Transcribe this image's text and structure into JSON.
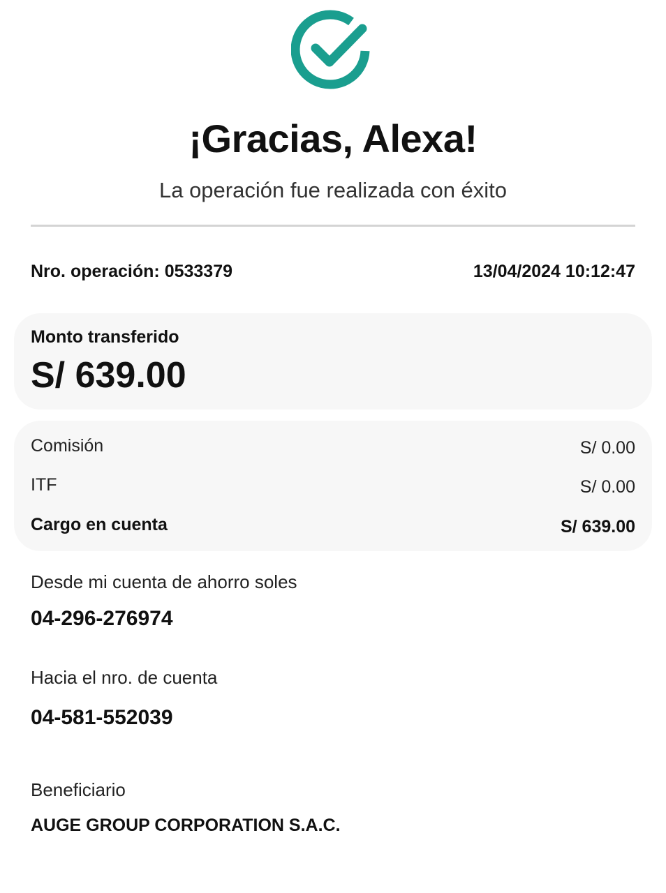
{
  "colors": {
    "accent": "#1a9e8f",
    "card_background": "#f7f7f7",
    "divider": "#d4d4d4"
  },
  "header": {
    "icon": "check-circle-icon",
    "title": "¡Gracias, Alexa!",
    "subtitle": "La operación fue realizada con éxito"
  },
  "operation": {
    "label": "Nro. operación: ",
    "number": "0533379",
    "datetime": "13/04/2024 10:12:47"
  },
  "amount": {
    "label": "Monto transferido",
    "value": "S/ 639.00"
  },
  "fees": [
    {
      "label": "Comisión",
      "value": "S/ 0.00"
    },
    {
      "label": "ITF",
      "value": "S/ 0.00"
    },
    {
      "label": "Cargo en cuenta",
      "value": "S/ 639.00"
    }
  ],
  "source_account": {
    "label": "Desde mi cuenta de ahorro soles",
    "value": "04-296-276974"
  },
  "destination_account": {
    "label": "Hacia el nro. de cuenta",
    "value": "04-581-552039"
  },
  "beneficiary": {
    "label": "Beneficiario",
    "name": "AUGE GROUP CORPORATION S.A.C."
  }
}
